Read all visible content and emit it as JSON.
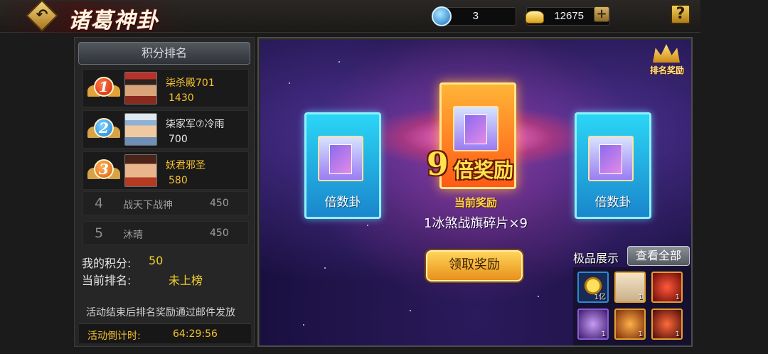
{
  "header": {
    "title": "诸葛神卦",
    "currency1": {
      "icon": "jade-coin-icon",
      "value": "3"
    },
    "currency2": {
      "icon": "gold-ingot-icon",
      "value": "12675"
    },
    "plus": "+",
    "help": "?",
    "back": "↶"
  },
  "ranking": {
    "header": "积分排名",
    "top": [
      {
        "rank": "1",
        "name": "柒杀殿701",
        "score": "1430"
      },
      {
        "rank": "2",
        "name": "柒家军⑦冷雨",
        "score": "700"
      },
      {
        "rank": "3",
        "name": "妖君邪圣",
        "score": "580"
      }
    ],
    "others": [
      {
        "rank": "4",
        "name": "战天下战神",
        "score": "450"
      },
      {
        "rank": "5",
        "name": "沐晴",
        "score": "450"
      }
    ],
    "my_score_label": "我的积分:",
    "my_score": "50",
    "current_rank_label": "当前排名:",
    "current_rank": "未上榜",
    "notice": "活动结束后排名奖励通过邮件发放",
    "countdown_label": "活动倒计时:",
    "countdown": "64:29:56"
  },
  "scene": {
    "rank_reward_label": "排名奖励",
    "left_card_label": "倍数卦",
    "right_card_label": "倍数卦",
    "multiplier_number": "9",
    "multiplier_text": "倍奖励",
    "current_reward_title": "当前奖励",
    "reward_item": "1冰煞战旗碎片×9",
    "claim_button": "领取奖励",
    "showcase_label": "极品展示",
    "view_all": "查看全部",
    "showcase_items": [
      {
        "icon": "gold-coin-icon",
        "qty": "1亿"
      },
      {
        "icon": "general-fragment-icon",
        "qty": "1"
      },
      {
        "icon": "red-general-icon",
        "qty": "1"
      },
      {
        "icon": "purple-fragment-icon",
        "qty": "1"
      },
      {
        "icon": "orange-general-icon",
        "qty": "1"
      },
      {
        "icon": "dark-general-icon",
        "qty": "1"
      }
    ]
  },
  "colors": {
    "gold_text": "#f4c02e",
    "panel_bg": "#262626",
    "scene_bg": "#251a55"
  }
}
